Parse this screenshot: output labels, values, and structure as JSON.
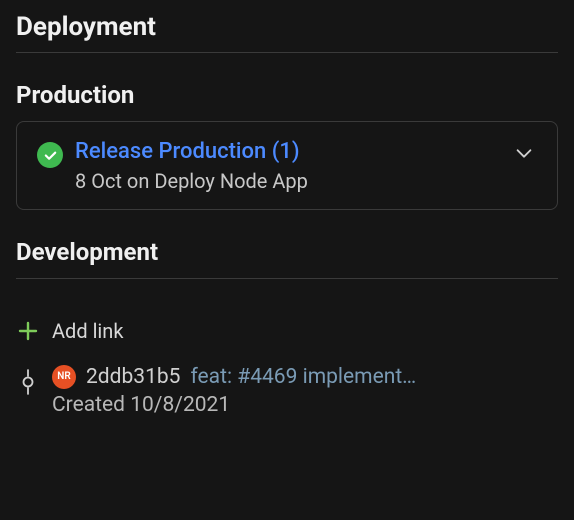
{
  "deployment": {
    "title": "Deployment"
  },
  "production": {
    "title": "Production",
    "release": {
      "title": "Release Production (1)",
      "subtitle": "8 Oct on Deploy Node App"
    }
  },
  "development": {
    "title": "Development",
    "add_link_label": "Add link",
    "commit": {
      "avatar_initials": "NR",
      "hash": "2ddb31b5",
      "message": "feat: #4469 implement…",
      "created_label": "Created 10/8/2021"
    }
  }
}
